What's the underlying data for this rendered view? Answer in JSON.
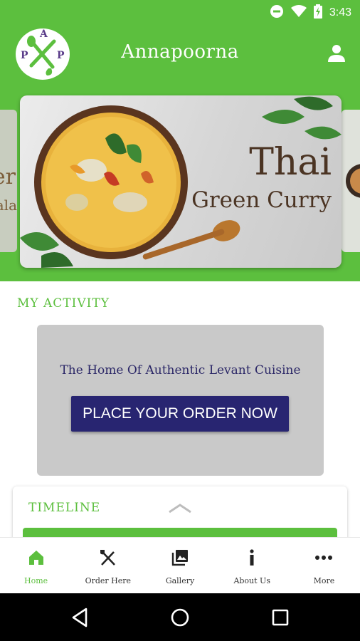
{
  "status_bar": {
    "time": "3:43",
    "icons": [
      "do-not-disturb-icon",
      "wifi-icon",
      "battery-charging-icon"
    ]
  },
  "app_bar": {
    "title": "Annapoorna",
    "logo_letters": [
      "P",
      "A",
      "P"
    ],
    "profile_icon": "person-icon"
  },
  "banner": {
    "title": "Thai",
    "subtitle": "Green Curry",
    "left_peek": "er",
    "left_peek_2": "ala"
  },
  "activity": {
    "section_label": "MY ACTIVITY",
    "promo_text": "The Home Of Authentic Levant Cuisine",
    "order_button": "PLACE YOUR ORDER NOW"
  },
  "timeline": {
    "label": "TIMELINE",
    "toggle_icon": "chevron-up-icon"
  },
  "bottom_nav": {
    "items": [
      {
        "label": "Home",
        "icon": "home-icon",
        "active": true
      },
      {
        "label": "Order Here",
        "icon": "fork-knife-icon",
        "active": false
      },
      {
        "label": "Gallery",
        "icon": "gallery-icon",
        "active": false
      },
      {
        "label": "About Us",
        "icon": "info-icon",
        "active": false
      },
      {
        "label": "More",
        "icon": "more-horizontal-icon",
        "active": false
      }
    ]
  },
  "colors": {
    "brand_green": "#5cbf3e",
    "button_navy": "#282571",
    "promo_gray": "#c9c9c9",
    "title_brown": "#4b3423"
  }
}
